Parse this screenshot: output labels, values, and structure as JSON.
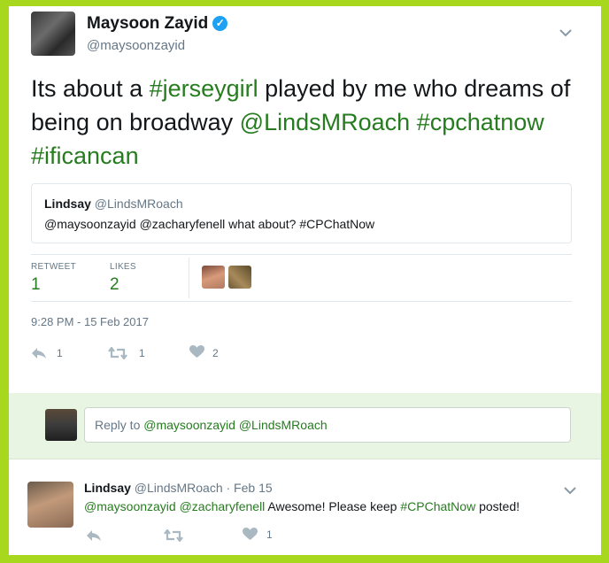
{
  "tweet": {
    "author_name": "Maysoon Zayid",
    "author_handle": "@maysoonzayid",
    "text_parts": {
      "p1": "Its about a ",
      "p2": "#jerseygirl",
      "p3": " played by me who dreams of being on broadway ",
      "p4": "@LindsMRoach",
      "p5": "#cpchatnow",
      "p6": "#ificancan"
    },
    "quote": {
      "name": "Lindsay",
      "handle": "@LindsMRoach",
      "text": "@maysoonzayid @zacharyfenell what about? #CPChatNow"
    },
    "stats": {
      "retweet_label": "RETWEET",
      "retweet_count": "1",
      "likes_label": "LIKES",
      "likes_count": "2"
    },
    "timestamp": "9:28 PM - 15 Feb 2017",
    "actions": {
      "reply_count": "1",
      "retweet_count": "1",
      "like_count": "2"
    }
  },
  "reply_box": {
    "prefix": "Reply to ",
    "mentions": "@maysoonzayid @LindsMRoach"
  },
  "reply_tweet": {
    "name": "Lindsay",
    "handle": "@LindsMRoach",
    "date": "· Feb 15",
    "mentions": "@maysoonzayid @zacharyfenell",
    "text_mid": " Awesome! Please keep ",
    "hashtag": "#CPChatNow",
    "text_end": " posted!",
    "like_count": "1"
  },
  "icons": {
    "reply": "reply-icon",
    "retweet": "retweet-icon",
    "like": "heart-icon",
    "menu": "chevron-down-icon",
    "verified": "verified-badge-icon"
  },
  "colors": {
    "accent": "#267c1f",
    "border_frame": "#a8d81e",
    "reply_area_bg": "#e8f5e3"
  }
}
